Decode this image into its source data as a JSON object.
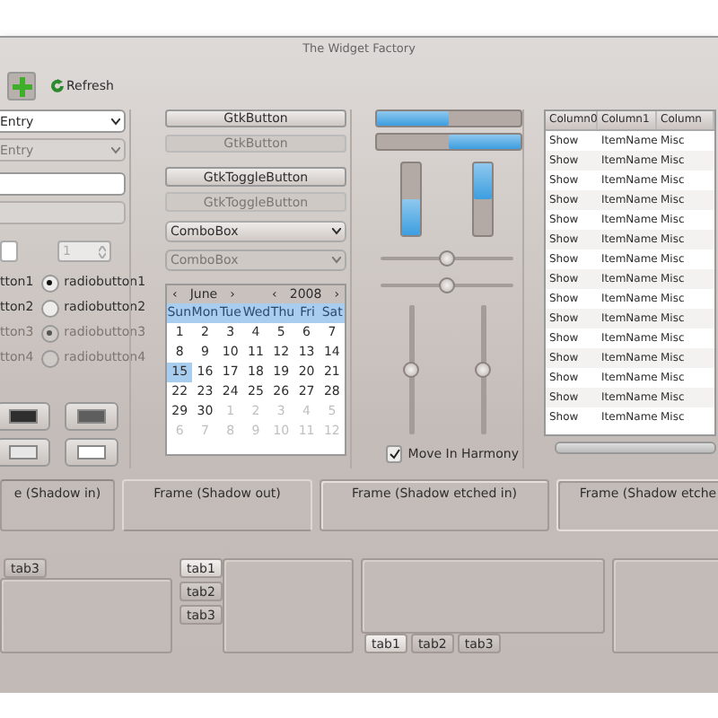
{
  "window": {
    "title": "The Widget Factory"
  },
  "toolbar": {
    "refresh_label": "Refresh",
    "add_pressed": true
  },
  "entries": [
    {
      "kind": "combo",
      "value": "Entry",
      "disabled": false
    },
    {
      "kind": "combo",
      "value": "Entry",
      "disabled": true
    },
    {
      "kind": "text",
      "disabled": false
    },
    {
      "kind": "text",
      "disabled": true
    }
  ],
  "spin_buttons": [
    {
      "disabled": false
    },
    {
      "value": "1",
      "disabled": true
    }
  ],
  "check_labels": [
    {
      "label": "tton1",
      "disabled": false
    },
    {
      "label": "tton2",
      "disabled": false
    },
    {
      "label": "tton3",
      "disabled": true
    },
    {
      "label": "tton4",
      "disabled": true
    }
  ],
  "radios": [
    {
      "label": "radiobutton1",
      "selected": true,
      "disabled": false
    },
    {
      "label": "radiobutton2",
      "selected": false,
      "disabled": false
    },
    {
      "label": "radiobutton3",
      "selected": true,
      "disabled": true
    },
    {
      "label": "radiobutton4",
      "selected": false,
      "disabled": true
    }
  ],
  "color_buttons": [
    {
      "color": "#2e2e2e"
    },
    {
      "color": "#5e5e5e"
    },
    {
      "color": "#e6e6e6"
    },
    {
      "color": "#ffffff"
    }
  ],
  "buttons": [
    {
      "kind": "button",
      "label": "GtkButton",
      "disabled": false
    },
    {
      "kind": "button",
      "label": "GtkButton",
      "disabled": true
    },
    {
      "kind": "toggle",
      "label": "GtkToggleButton",
      "disabled": false
    },
    {
      "kind": "toggle",
      "label": "GtkToggleButton",
      "disabled": true
    }
  ],
  "combos": [
    {
      "label": "ComboBox",
      "disabled": false
    },
    {
      "label": "ComboBox",
      "disabled": true
    }
  ],
  "calendar": {
    "prev_month": "‹",
    "month": "June",
    "next_month": "›",
    "prev_year": "‹",
    "year": "2008",
    "next_year": "›",
    "weekdays": [
      "Sun",
      "Mon",
      "Tue",
      "Wed",
      "Thu",
      "Fri",
      "Sat"
    ],
    "weeks": [
      [
        {
          "day": "1",
          "dim": false,
          "selected": false
        },
        {
          "day": "2",
          "dim": false,
          "selected": false
        },
        {
          "day": "3",
          "dim": false,
          "selected": false
        },
        {
          "day": "4",
          "dim": false,
          "selected": false
        },
        {
          "day": "5",
          "dim": false,
          "selected": false
        },
        {
          "day": "6",
          "dim": false,
          "selected": false
        },
        {
          "day": "7",
          "dim": false,
          "selected": false
        }
      ],
      [
        {
          "day": "8",
          "dim": false,
          "selected": false
        },
        {
          "day": "9",
          "dim": false,
          "selected": false
        },
        {
          "day": "10",
          "dim": false,
          "selected": false
        },
        {
          "day": "11",
          "dim": false,
          "selected": false
        },
        {
          "day": "12",
          "dim": false,
          "selected": false
        },
        {
          "day": "13",
          "dim": false,
          "selected": false
        },
        {
          "day": "14",
          "dim": false,
          "selected": false
        }
      ],
      [
        {
          "day": "15",
          "dim": false,
          "selected": true
        },
        {
          "day": "16",
          "dim": false,
          "selected": false
        },
        {
          "day": "17",
          "dim": false,
          "selected": false
        },
        {
          "day": "18",
          "dim": false,
          "selected": false
        },
        {
          "day": "19",
          "dim": false,
          "selected": false
        },
        {
          "day": "20",
          "dim": false,
          "selected": false
        },
        {
          "day": "21",
          "dim": false,
          "selected": false
        }
      ],
      [
        {
          "day": "22",
          "dim": false,
          "selected": false
        },
        {
          "day": "23",
          "dim": false,
          "selected": false
        },
        {
          "day": "24",
          "dim": false,
          "selected": false
        },
        {
          "day": "25",
          "dim": false,
          "selected": false
        },
        {
          "day": "26",
          "dim": false,
          "selected": false
        },
        {
          "day": "27",
          "dim": false,
          "selected": false
        },
        {
          "day": "28",
          "dim": false,
          "selected": false
        }
      ],
      [
        {
          "day": "29",
          "dim": false,
          "selected": false
        },
        {
          "day": "30",
          "dim": false,
          "selected": false
        },
        {
          "day": "1",
          "dim": true,
          "selected": false
        },
        {
          "day": "2",
          "dim": true,
          "selected": false
        },
        {
          "day": "3",
          "dim": true,
          "selected": false
        },
        {
          "day": "4",
          "dim": true,
          "selected": false
        },
        {
          "day": "5",
          "dim": true,
          "selected": false
        }
      ],
      [
        {
          "day": "6",
          "dim": true,
          "selected": false
        },
        {
          "day": "7",
          "dim": true,
          "selected": false
        },
        {
          "day": "8",
          "dim": true,
          "selected": false
        },
        {
          "day": "9",
          "dim": true,
          "selected": false
        },
        {
          "day": "10",
          "dim": true,
          "selected": false
        },
        {
          "day": "11",
          "dim": true,
          "selected": false
        },
        {
          "day": "12",
          "dim": true,
          "selected": false
        }
      ]
    ]
  },
  "progress_bars": [
    {
      "kind": "horizontal",
      "inverted": false,
      "level": 0.5
    },
    {
      "kind": "horizontal",
      "inverted": true,
      "level": 0.5
    },
    {
      "kind": "vertical",
      "inverted": true,
      "level": 0.5
    },
    {
      "kind": "vertical",
      "inverted": false,
      "level": 0.5
    }
  ],
  "hscales": [
    {
      "level": 0.5
    },
    {
      "level": 0.5
    }
  ],
  "vscales": [
    {
      "level": 0.5
    },
    {
      "level": 0.5
    }
  ],
  "harmony": {
    "label": "Move In Harmony",
    "checked": true
  },
  "tree": {
    "columns": [
      "Column0",
      "Column1",
      "Column"
    ],
    "rows": [
      [
        "Show",
        "ItemName",
        "Misc"
      ],
      [
        "Show",
        "ItemName",
        "Misc"
      ],
      [
        "Show",
        "ItemName",
        "Misc"
      ],
      [
        "Show",
        "ItemName",
        "Misc"
      ],
      [
        "Show",
        "ItemName",
        "Misc"
      ],
      [
        "Show",
        "ItemName",
        "Misc"
      ],
      [
        "Show",
        "ItemName",
        "Misc"
      ],
      [
        "Show",
        "ItemName",
        "Misc"
      ],
      [
        "Show",
        "ItemName",
        "Misc"
      ],
      [
        "Show",
        "ItemName",
        "Misc"
      ],
      [
        "Show",
        "ItemName",
        "Misc"
      ],
      [
        "Show",
        "ItemName",
        "Misc"
      ],
      [
        "Show",
        "ItemName",
        "Misc"
      ],
      [
        "Show",
        "ItemName",
        "Misc"
      ],
      [
        "Show",
        "ItemName",
        "Misc"
      ]
    ]
  },
  "frames": [
    {
      "label": "e (Shadow in)",
      "kind": "in"
    },
    {
      "label": "Frame (Shadow out)",
      "kind": "out"
    },
    {
      "label": "Frame (Shadow etched in)",
      "kind": "etched_in"
    },
    {
      "label": "Frame (Shadow etche",
      "kind": "etched_out"
    }
  ],
  "notebooks": [
    {
      "kind": "top",
      "tabs": [
        {
          "label": "tab3",
          "selected": false
        }
      ]
    },
    {
      "kind": "left",
      "tabs": [
        {
          "label": "tab1",
          "selected": true
        },
        {
          "label": "tab2",
          "selected": false
        },
        {
          "label": "tab3",
          "selected": false
        }
      ]
    },
    {
      "kind": "bottom",
      "tabs": [
        {
          "label": "tab1",
          "selected": true
        },
        {
          "label": "tab2",
          "selected": false
        },
        {
          "label": "tab3",
          "selected": false
        }
      ]
    },
    {
      "kind": "right"
    }
  ]
}
